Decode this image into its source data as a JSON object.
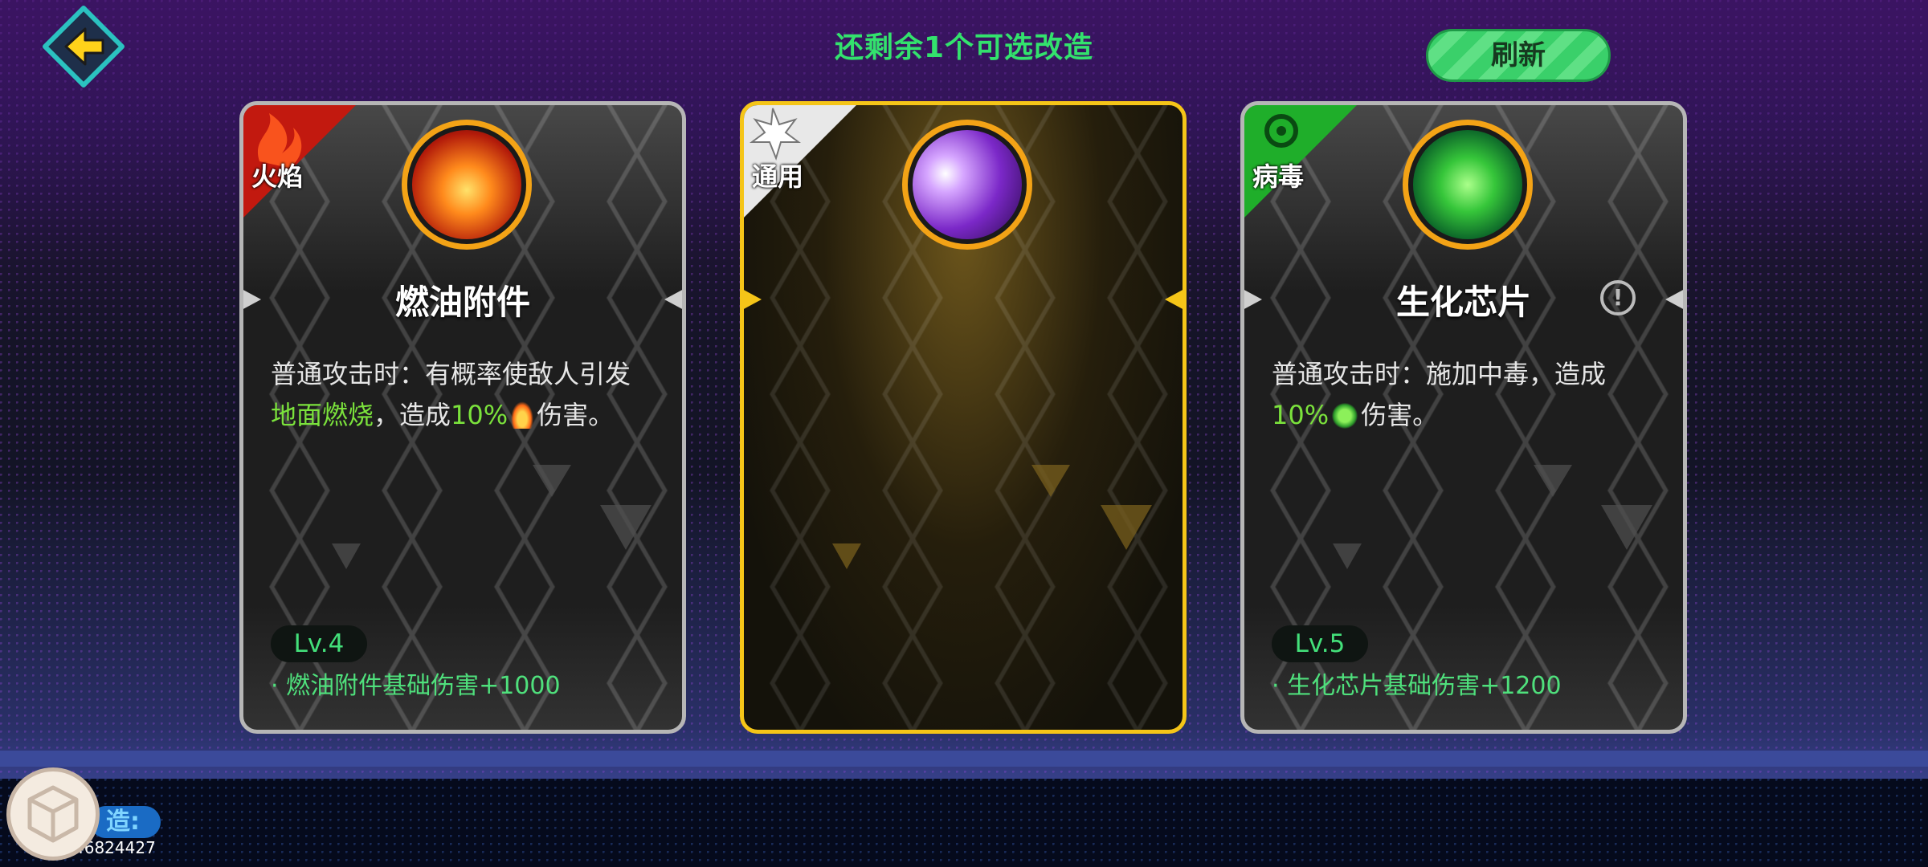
{
  "header": {
    "title": "还剩余1个可选改造",
    "refresh_label": "刷新"
  },
  "cards": [
    {
      "category": "火焰",
      "name": "燃油附件",
      "desc_line1": "普通攻击时：有概率使敌人引发",
      "desc_hl1": "地面燃烧",
      "desc_mid": "，造成",
      "desc_hl2": "10%",
      "desc_tail": "伤害。",
      "level": "Lv.4",
      "bonus": "· 燃油附件基础伤害+1000"
    },
    {
      "category": "通用",
      "name": "",
      "selected": true
    },
    {
      "category": "病毒",
      "name": "生化芯片",
      "desc_line1": "普通攻击时：施加中毒，造成",
      "desc_hl2": "10%",
      "desc_tail": "伤害。",
      "level": "Lv.5",
      "bonus": "· 生化芯片基础伤害+1200"
    }
  ],
  "footer": {
    "label": "造:",
    "id": "46824427"
  },
  "colors": {
    "accent_green": "#33e26d",
    "selected_border": "#f5c518",
    "icon_ring": "#f3a316"
  }
}
